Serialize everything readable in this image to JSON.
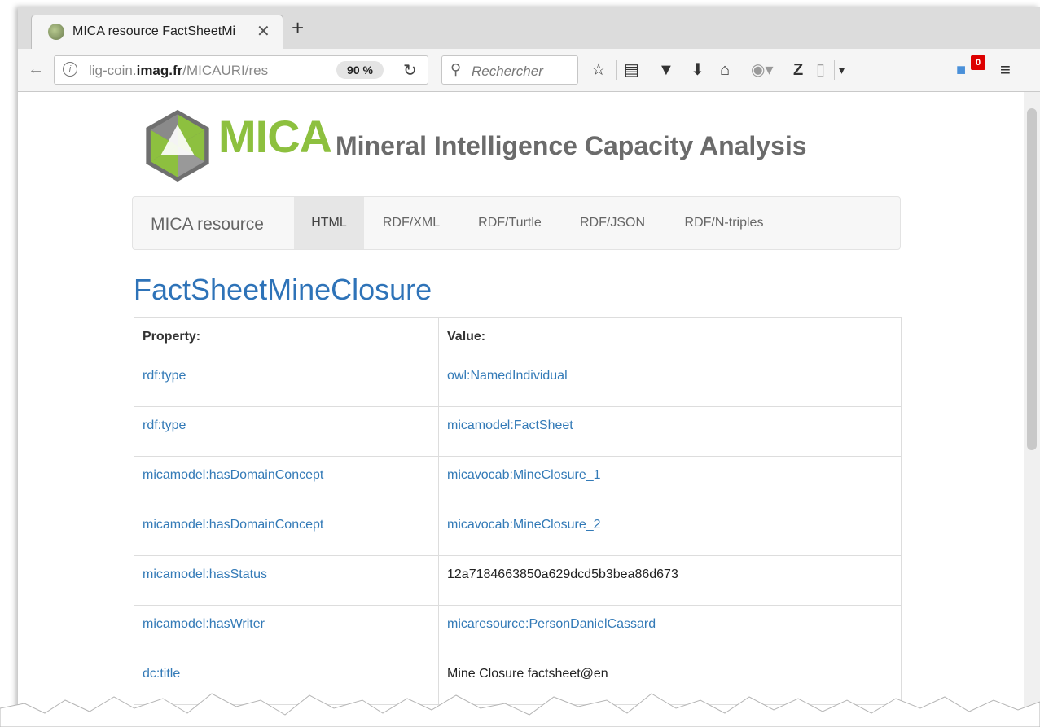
{
  "browser": {
    "tab_title": "MICA resource FactSheetMi",
    "url_host_prefix": "lig-coin.",
    "url_host_main": "imag.fr",
    "url_path": "/MICAURI/res",
    "zoom": "90 %",
    "search_placeholder": "Rechercher",
    "notification_count": "0"
  },
  "header": {
    "brand": "MICA",
    "tagline": "Mineral Intelligence Capacity Analysis",
    "colors": {
      "brand": "#8dc03f",
      "logo_grey": "#707070",
      "link": "#337ab7"
    }
  },
  "nav": {
    "brand": "MICA resource",
    "items": [
      {
        "label": "HTML",
        "active": true
      },
      {
        "label": "RDF/XML"
      },
      {
        "label": "RDF/Turtle"
      },
      {
        "label": "RDF/JSON"
      },
      {
        "label": "RDF/N-triples"
      }
    ]
  },
  "page": {
    "title": "FactSheetMineClosure",
    "table": {
      "headers": [
        "Property:",
        "Value:"
      ],
      "rows": [
        {
          "property": "rdf:type",
          "value": "owl:NamedIndividual"
        },
        {
          "property": "rdf:type",
          "value": "micamodel:FactSheet"
        },
        {
          "property": "micamodel:hasDomainConcept",
          "value": "micavocab:MineClosure_1"
        },
        {
          "property": "micamodel:hasDomainConcept",
          "value": "micavocab:MineClosure_2"
        },
        {
          "property": "micamodel:hasStatus",
          "value": "12a7184663850a629dcd5b3bea86d673"
        },
        {
          "property": "micamodel:hasWriter",
          "value": "micaresource:PersonDanielCassard"
        },
        {
          "property": "dc:title",
          "value": "Mine Closure factsheet@en"
        }
      ]
    }
  }
}
